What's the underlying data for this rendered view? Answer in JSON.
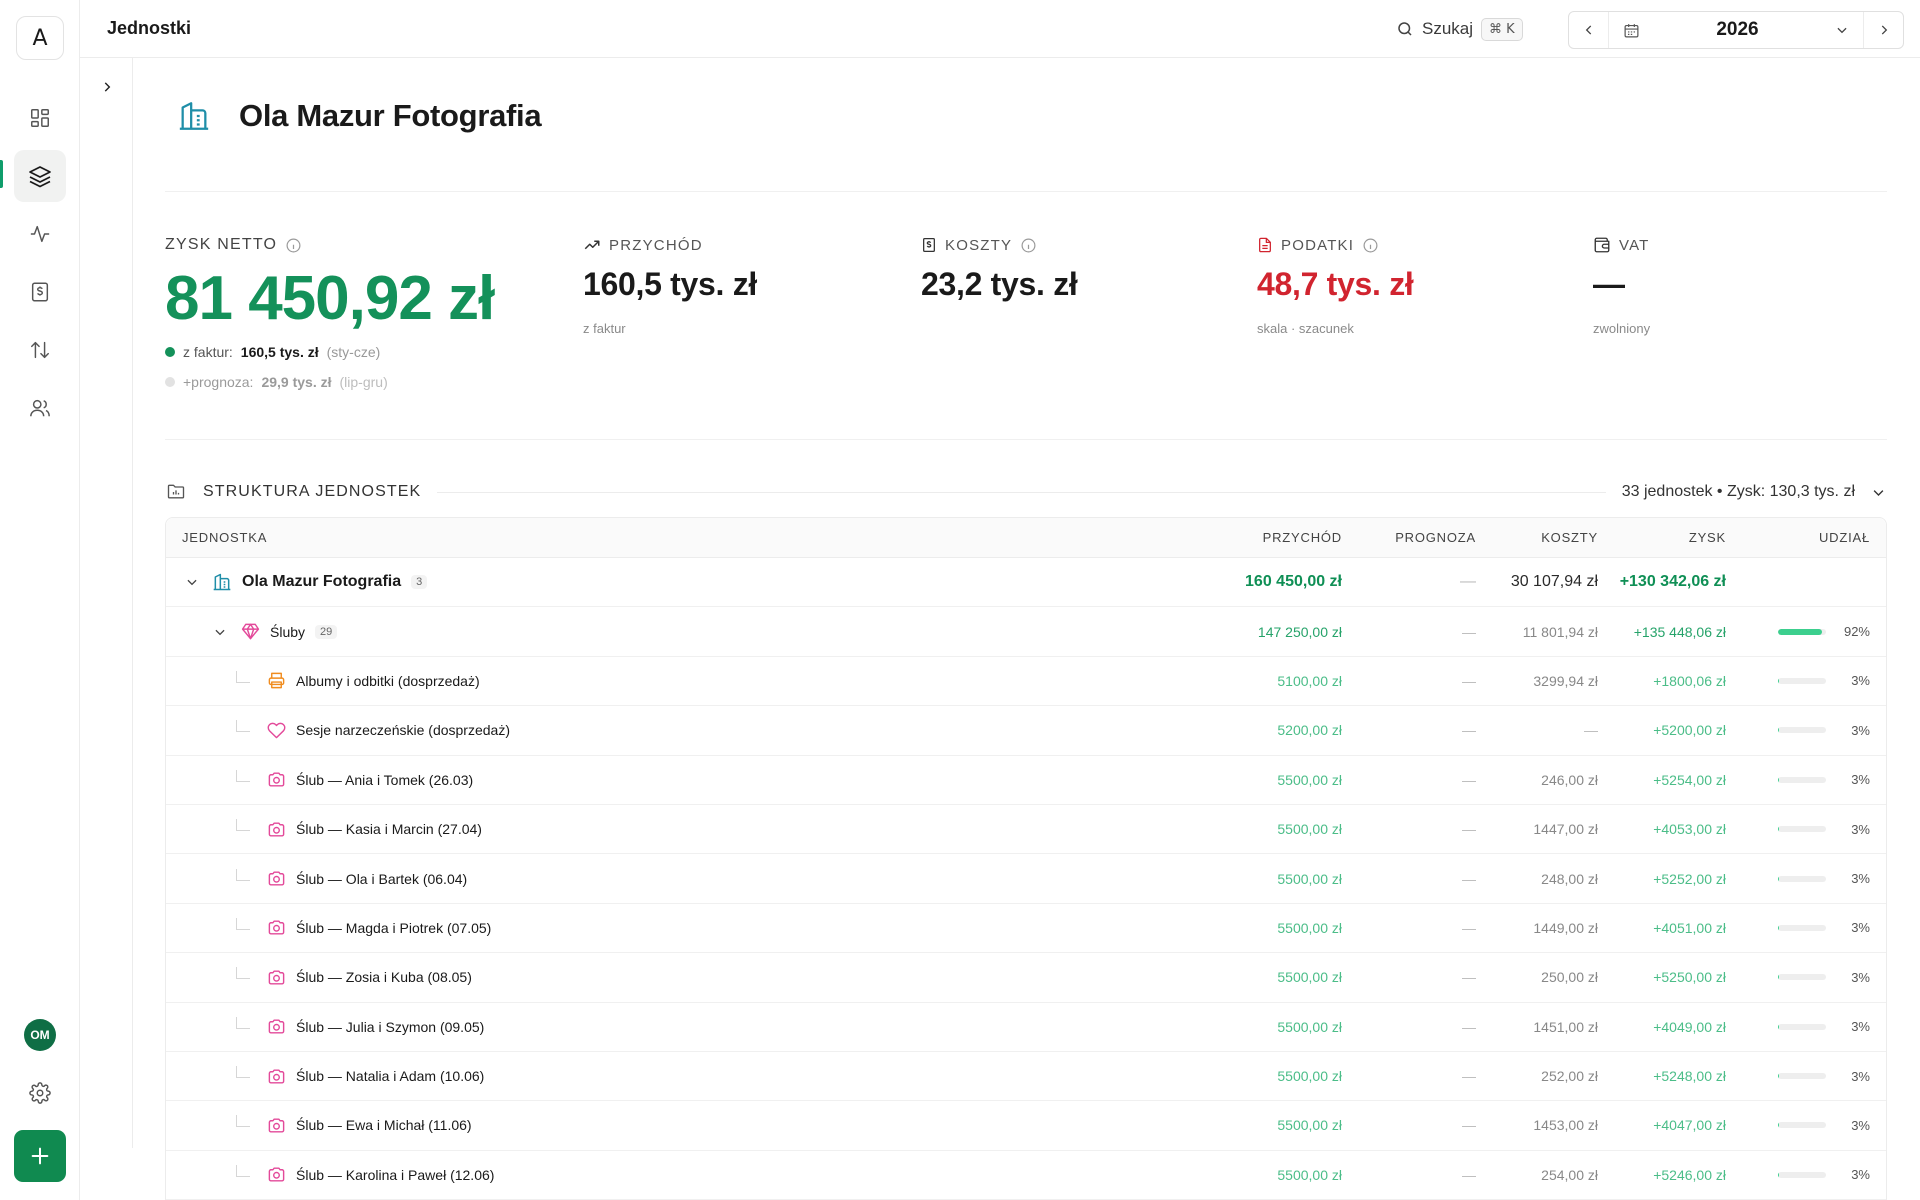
{
  "app": {
    "logo_letter": "A",
    "page_heading": "Jednostki"
  },
  "search": {
    "label": "Szukaj",
    "shortcut": "⌘ K"
  },
  "year_picker": {
    "year": "2026"
  },
  "user": {
    "initials": "OM"
  },
  "rail": [
    {
      "name": "dashboard-icon",
      "active": false
    },
    {
      "name": "layers-icon",
      "active": true
    },
    {
      "name": "activity-icon",
      "active": false
    },
    {
      "name": "invoice-icon",
      "active": false
    },
    {
      "name": "transfer-icon",
      "active": false
    },
    {
      "name": "users-icon",
      "active": false
    }
  ],
  "entity": {
    "title": "Ola Mazur Fotografia",
    "icon": "building-icon"
  },
  "stats": {
    "netto": {
      "label": "ZYSK NETTO",
      "value": "81 450,92 zł",
      "from_invoices_label": "z faktur:",
      "from_invoices_value": "160,5 tys. zł",
      "from_invoices_range": "(sty-cze)",
      "forecast_label": "+prognoza:",
      "forecast_value": "29,9 tys. zł",
      "forecast_range": "(lip-gru)"
    },
    "revenue": {
      "label": "PRZYCHÓD",
      "value": "160,5 tys. zł",
      "note": "z faktur"
    },
    "costs": {
      "label": "KOSZTY",
      "value": "23,2 tys. zł",
      "note": ""
    },
    "taxes": {
      "label": "PODATKI",
      "value": "48,7 tys. zł",
      "note": "skala · szacunek"
    },
    "vat": {
      "label": "VAT",
      "value": "—",
      "note": "zwolniony"
    }
  },
  "colors": {
    "accent": "#14915a",
    "tax_red": "#d1242f",
    "pink": "#e34a9a",
    "orange": "#f08c1f"
  },
  "structure": {
    "title": "STRUKTURA JEDNOSTEK",
    "summary": "33 jednostek • Zysk: 130,3 tys. zł",
    "columns": {
      "name": "JEDNOSTKA",
      "revenue": "PRZYCHÓD",
      "forecast": "PROGNOZA",
      "costs": "KOSZTY",
      "profit": "ZYSK",
      "share": "UDZIAŁ"
    },
    "root": {
      "name": "Ola Mazur Fotografia",
      "count": "3",
      "revenue": "160 450,00 zł",
      "forecast": "—",
      "costs": "30 107,94 zł",
      "profit": "+130 342,06 zł"
    },
    "group": {
      "name": "Śluby",
      "count": "29",
      "revenue": "147 250,00 zł",
      "forecast": "—",
      "costs": "11 801,94 zł",
      "profit": "+135 448,06 zł",
      "share": "92%",
      "share_value": 92
    },
    "items": [
      {
        "name": "Albumy i odbitki (dosprzedaż)",
        "icon": "printer-icon",
        "color": "#f08c1f",
        "revenue": "5100,00 zł",
        "forecast": "—",
        "costs": "3299,94 zł",
        "profit": "+1800,06 zł",
        "share": "3%",
        "share_value": 3
      },
      {
        "name": "Sesje narzeczeńskie (dosprzedaż)",
        "icon": "heart-icon",
        "color": "#e34a9a",
        "revenue": "5200,00 zł",
        "forecast": "—",
        "costs": "—",
        "profit": "+5200,00 zł",
        "share": "3%",
        "share_value": 3
      },
      {
        "name": "Ślub — Ania i Tomek (26.03)",
        "icon": "camera-icon",
        "color": "#e34a9a",
        "revenue": "5500,00 zł",
        "forecast": "—",
        "costs": "246,00 zł",
        "profit": "+5254,00 zł",
        "share": "3%",
        "share_value": 3
      },
      {
        "name": "Ślub — Kasia i Marcin (27.04)",
        "icon": "camera-icon",
        "color": "#e34a9a",
        "revenue": "5500,00 zł",
        "forecast": "—",
        "costs": "1447,00 zł",
        "profit": "+4053,00 zł",
        "share": "3%",
        "share_value": 3
      },
      {
        "name": "Ślub — Ola i Bartek (06.04)",
        "icon": "camera-icon",
        "color": "#e34a9a",
        "revenue": "5500,00 zł",
        "forecast": "—",
        "costs": "248,00 zł",
        "profit": "+5252,00 zł",
        "share": "3%",
        "share_value": 3
      },
      {
        "name": "Ślub — Magda i Piotrek (07.05)",
        "icon": "camera-icon",
        "color": "#e34a9a",
        "revenue": "5500,00 zł",
        "forecast": "—",
        "costs": "1449,00 zł",
        "profit": "+4051,00 zł",
        "share": "3%",
        "share_value": 3
      },
      {
        "name": "Ślub — Zosia i Kuba (08.05)",
        "icon": "camera-icon",
        "color": "#e34a9a",
        "revenue": "5500,00 zł",
        "forecast": "—",
        "costs": "250,00 zł",
        "profit": "+5250,00 zł",
        "share": "3%",
        "share_value": 3
      },
      {
        "name": "Ślub — Julia i Szymon (09.05)",
        "icon": "camera-icon",
        "color": "#e34a9a",
        "revenue": "5500,00 zł",
        "forecast": "—",
        "costs": "1451,00 zł",
        "profit": "+4049,00 zł",
        "share": "3%",
        "share_value": 3
      },
      {
        "name": "Ślub — Natalia i Adam (10.06)",
        "icon": "camera-icon",
        "color": "#e34a9a",
        "revenue": "5500,00 zł",
        "forecast": "—",
        "costs": "252,00 zł",
        "profit": "+5248,00 zł",
        "share": "3%",
        "share_value": 3
      },
      {
        "name": "Ślub — Ewa i Michał (11.06)",
        "icon": "camera-icon",
        "color": "#e34a9a",
        "revenue": "5500,00 zł",
        "forecast": "—",
        "costs": "1453,00 zł",
        "profit": "+4047,00 zł",
        "share": "3%",
        "share_value": 3
      },
      {
        "name": "Ślub — Karolina i Paweł (12.06)",
        "icon": "camera-icon",
        "color": "#e34a9a",
        "revenue": "5500,00 zł",
        "forecast": "—",
        "costs": "254,00 zł",
        "profit": "+5246,00 zł",
        "share": "3%",
        "share_value": 3
      }
    ]
  }
}
